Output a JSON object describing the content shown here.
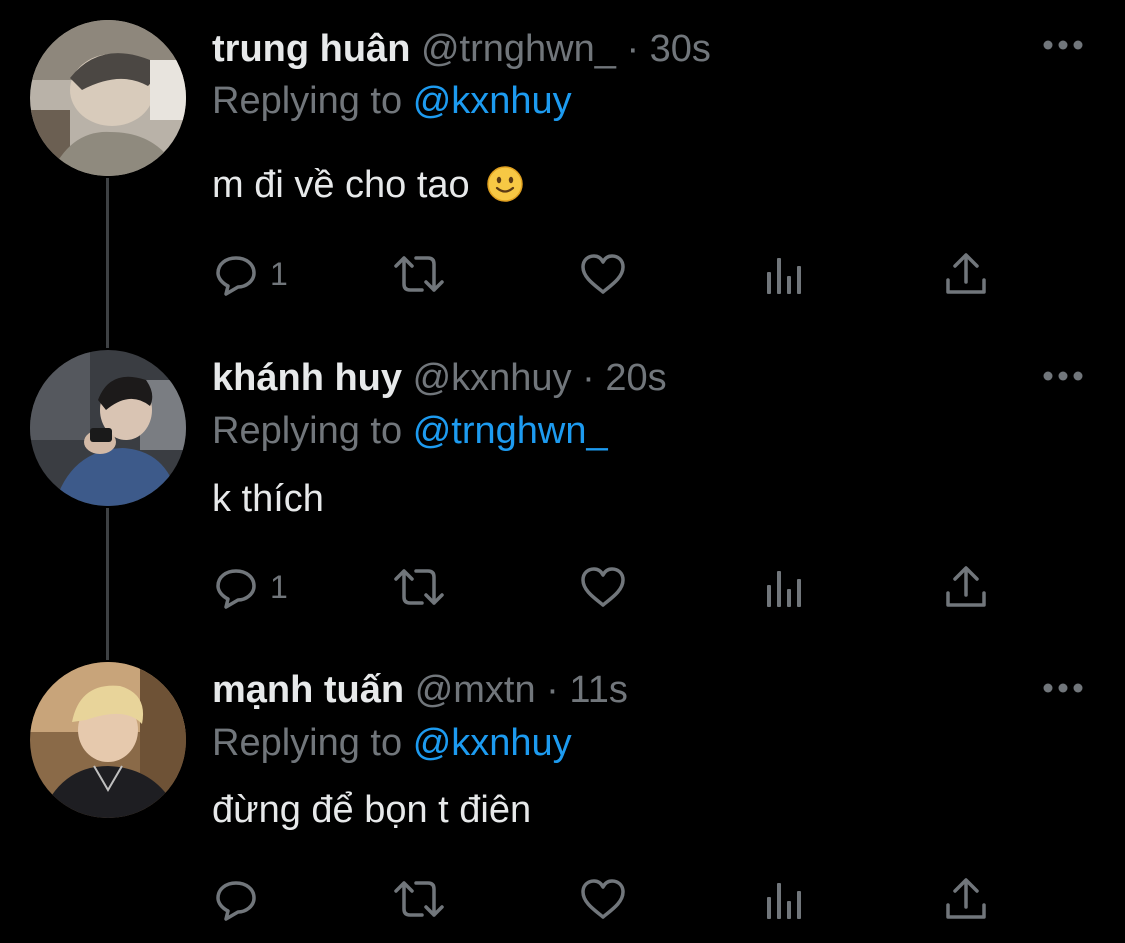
{
  "tweets": [
    {
      "name": "trung huân",
      "handle": "@trnghwn_",
      "separator": "·",
      "time": "30s",
      "replying_label": "Replying to",
      "replying_to": "@kxnhuy",
      "text": "m đi về cho tao",
      "emoji": "slightly-smiling-face",
      "reply_count": "1",
      "avatar": "avatar-photo-dark-hair-lying"
    },
    {
      "name": "khánh huy",
      "handle": "@kxnhuy",
      "separator": "·",
      "time": "20s",
      "replying_label": "Replying to",
      "replying_to": "@trnghwn_",
      "text": "k thích",
      "reply_count": "1",
      "avatar": "avatar-photo-blue-shirt-phone"
    },
    {
      "name": "mạnh tuấn",
      "handle": "@mxtn",
      "separator": "·",
      "time": "11s",
      "replying_label": "Replying to",
      "replying_to": "@kxnhuy",
      "text": "đừng để bọn t điên",
      "reply_count": "",
      "avatar": "avatar-photo-blonde-hair"
    }
  ],
  "colors": {
    "background": "#000000",
    "text_primary": "#e7e9ea",
    "text_secondary": "#71767b",
    "link": "#1d9bf0",
    "thread_line": "#3e4144"
  },
  "icons": [
    "reply-icon",
    "retweet-icon",
    "like-icon",
    "analytics-icon",
    "share-icon",
    "more-icon"
  ]
}
